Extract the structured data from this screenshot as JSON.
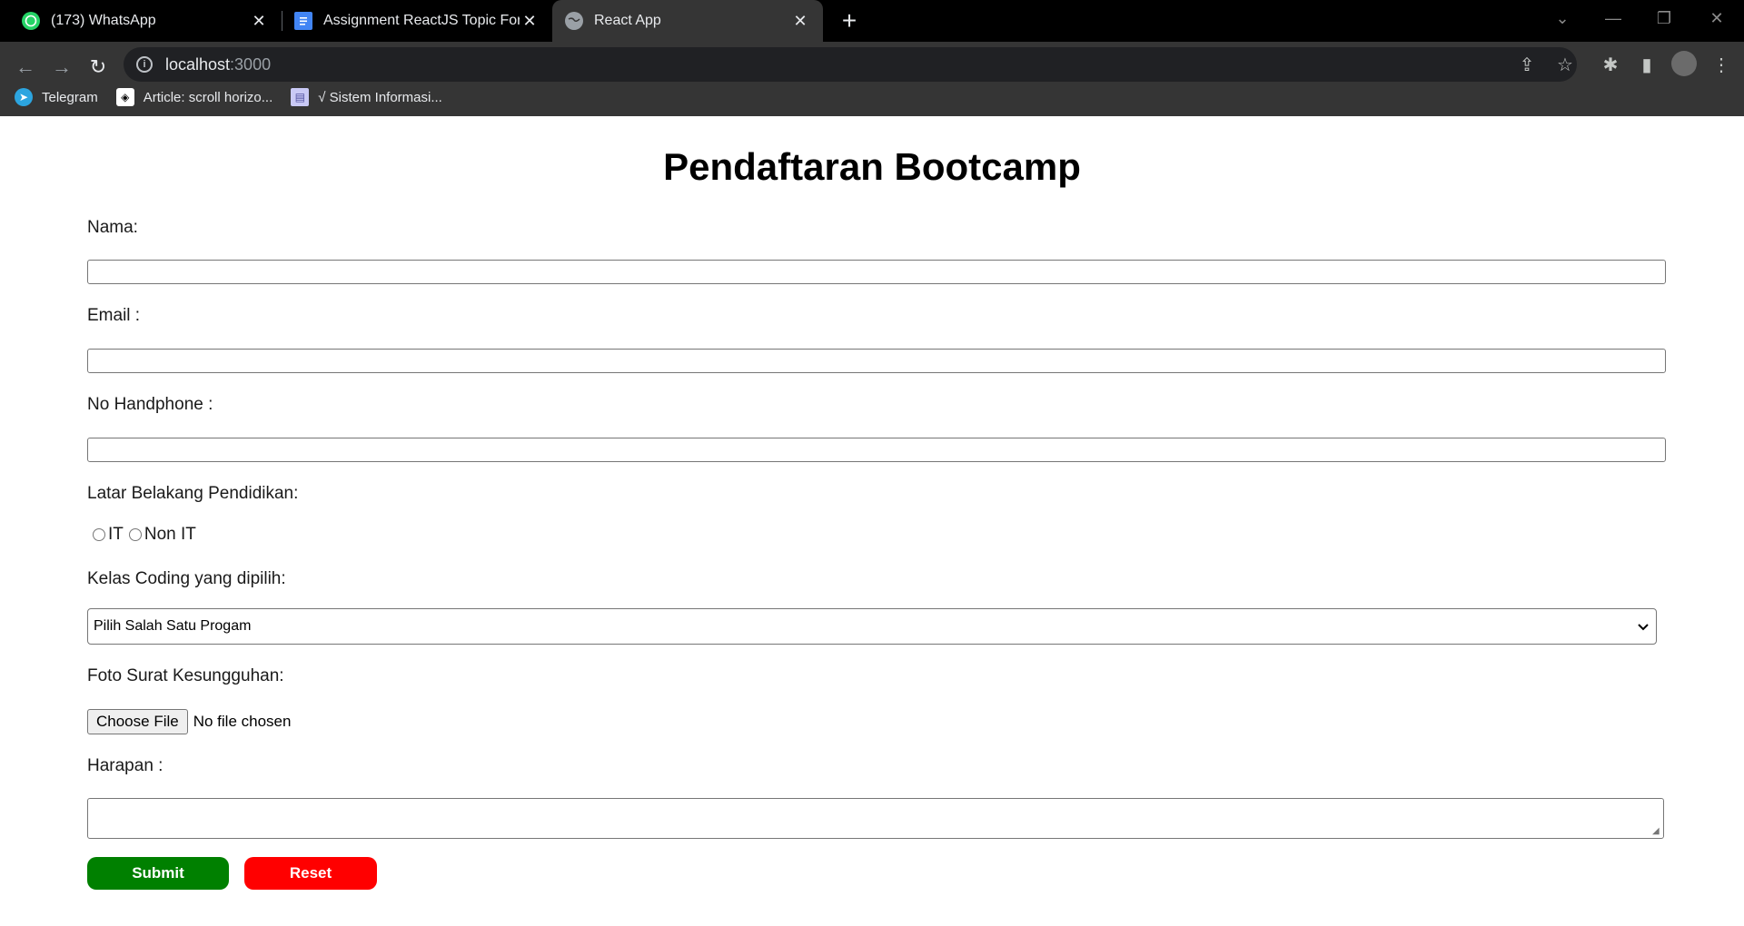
{
  "browser": {
    "tabs": [
      {
        "title": "(173) WhatsApp",
        "icon": "whatsapp-icon"
      },
      {
        "title": "Assignment ReactJS Topic Form -",
        "icon": "docs-icon"
      },
      {
        "title": "React App",
        "icon": "globe-icon"
      }
    ],
    "address": {
      "host": "localhost",
      "port": ":3000"
    },
    "bookmarks": [
      {
        "label": "Telegram",
        "icon": "telegram-icon"
      },
      {
        "label": "Article: scroll horizo...",
        "icon": "codepen-icon"
      },
      {
        "label": "√ Sistem Informasi...",
        "icon": "page-icon"
      }
    ]
  },
  "form": {
    "title": "Pendaftaran Bootcamp",
    "nama_label": "Nama:",
    "nama_value": "",
    "email_label": "Email :",
    "email_value": "",
    "hp_label": "No Handphone :",
    "hp_value": "",
    "pendidikan_label": "Latar Belakang Pendidikan:",
    "pendidikan_options": [
      "IT",
      "Non IT"
    ],
    "kelas_label": "Kelas Coding yang dipilih:",
    "kelas_selected": "Pilih Salah Satu Progam",
    "foto_label": "Foto Surat Kesungguhan:",
    "file_button": "Choose File",
    "file_status": "No file chosen",
    "harapan_label": "Harapan :",
    "harapan_value": "",
    "submit_label": "Submit",
    "reset_label": "Reset"
  },
  "colors": {
    "submit": "#008000",
    "reset": "#ff0000",
    "tabbar": "#000000",
    "toolbar": "#353535"
  }
}
